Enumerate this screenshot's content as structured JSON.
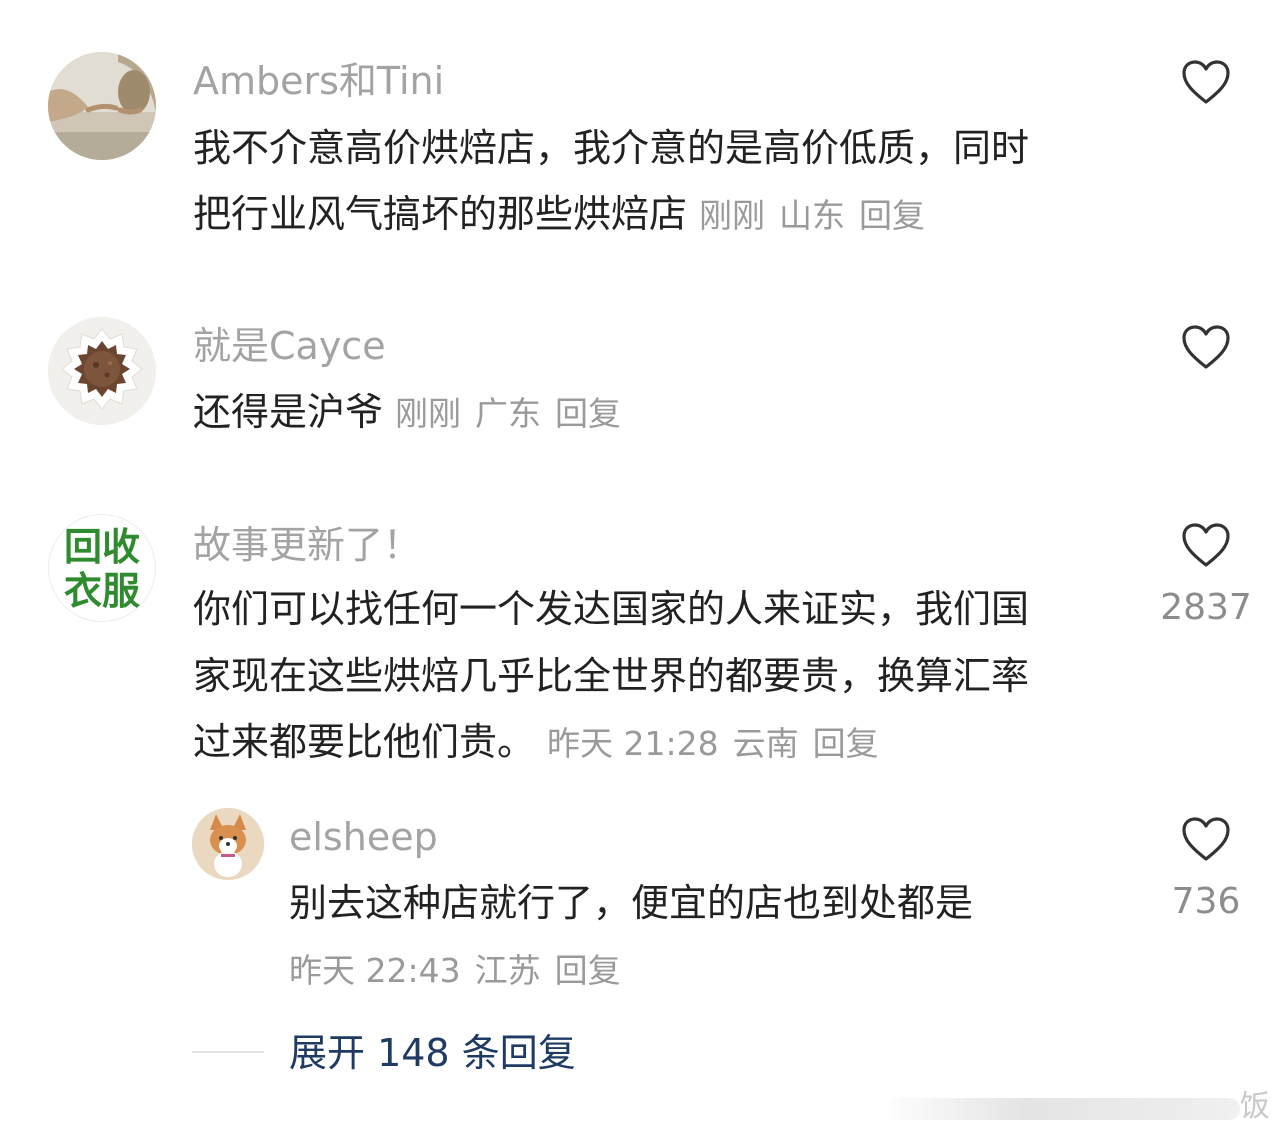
{
  "comments": [
    {
      "username": "Ambers和Tini",
      "avatar_icon": "creation-of-adam-avatar",
      "lines": [
        "我不介意高价烘焙店，我介意的是高价低质，同时",
        "把行业风气搞坏的那些烘焙店"
      ],
      "time": "刚刚",
      "location": "山东",
      "reply_label": "回复",
      "like_icon": "heart-outline-icon",
      "likes": ""
    },
    {
      "username": "就是Cayce",
      "avatar_icon": "coffee-filter-avatar",
      "lines": [
        "还得是沪爷"
      ],
      "time": "刚刚",
      "location": "广东",
      "reply_label": "回复",
      "like_icon": "heart-outline-icon",
      "likes": ""
    },
    {
      "username": "故事更新了！",
      "avatar_icon": "text-avatar",
      "avatar_text": [
        "回收",
        "衣服"
      ],
      "avatar_text_color": "#2e8b2e",
      "lines": [
        "你们可以找任何一个发达国家的人来证实，我们国",
        "家现在这些烘焙几乎比全世界的都要贵，换算汇率",
        "过来都要比他们贵。"
      ],
      "time": "昨天 21:28",
      "location": "云南",
      "reply_label": "回复",
      "like_icon": "heart-outline-icon",
      "likes": "2837",
      "replies": [
        {
          "username": "elsheep",
          "avatar_icon": "corgi-avatar",
          "lines": [
            "别去这种店就行了，便宜的店也到处都是"
          ],
          "time": "昨天 22:43",
          "location": "江苏",
          "reply_label": "回复",
          "like_icon": "heart-outline-icon",
          "likes": "736"
        }
      ],
      "expand_label": "展开 148 条回复"
    }
  ],
  "watermark": "饭",
  "colors": {
    "username": "#a3a3a3",
    "body": "#222222",
    "meta": "#9a9a9a",
    "expand_link": "#1f3b64"
  }
}
